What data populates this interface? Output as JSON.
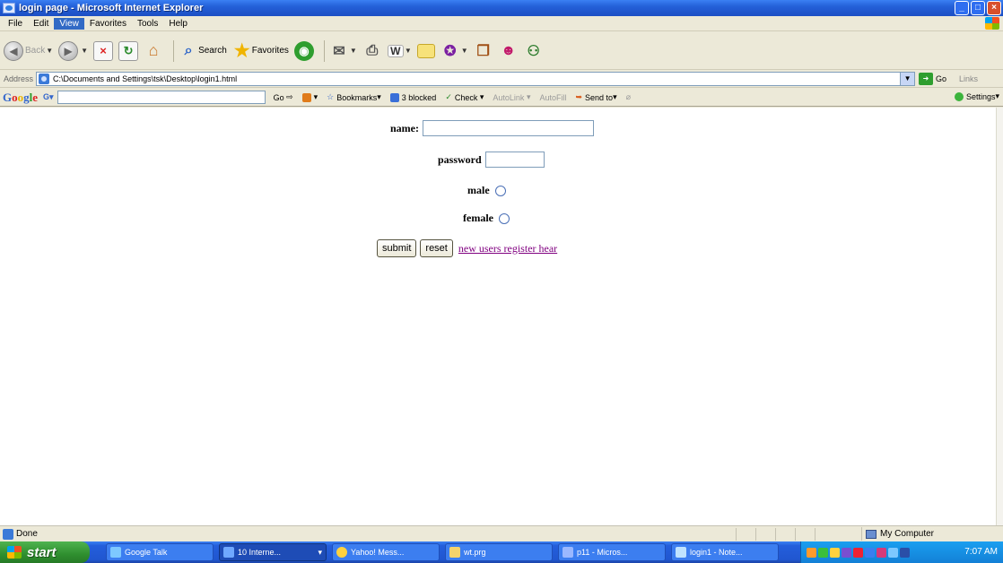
{
  "window": {
    "title": "login page - Microsoft Internet Explorer"
  },
  "menu": {
    "items": [
      "File",
      "Edit",
      "View",
      "Favorites",
      "Tools",
      "Help"
    ],
    "active": "View"
  },
  "toolbar": {
    "back_label": "Back",
    "search_label": "Search",
    "favorites_label": "Favorites"
  },
  "address": {
    "label": "Address",
    "url": "C:\\Documents and Settings\\tsk\\Desktop\\login1.html",
    "go_label": "Go",
    "links_label": "Links"
  },
  "google_toolbar": {
    "logo": "Google",
    "go_label": "Go",
    "bookmarks_label": "Bookmarks",
    "blocked_label": "3 blocked",
    "check_label": "Check",
    "autolink_label": "AutoLink",
    "autofill_label": "AutoFill",
    "sendto_label": "Send to",
    "settings_label": "Settings"
  },
  "form": {
    "name_label": "name:",
    "name_value": "",
    "password_label": "password",
    "password_value": "",
    "male_label": "male",
    "female_label": "female",
    "submit_label": "submit",
    "reset_label": "reset",
    "register_link": "new users register hear"
  },
  "status": {
    "text": "Done",
    "zone": "My Computer"
  },
  "taskbar": {
    "start_label": "start",
    "items": [
      {
        "label": "Google Talk",
        "active": false
      },
      {
        "label": "10 Interne...",
        "active": true
      },
      {
        "label": "Yahoo! Mess...",
        "active": false
      },
      {
        "label": "wt.prg",
        "active": false
      },
      {
        "label": "p11 - Micros...",
        "active": false
      },
      {
        "label": "login1 - Note...",
        "active": false
      }
    ],
    "clock": "7:07 AM"
  }
}
